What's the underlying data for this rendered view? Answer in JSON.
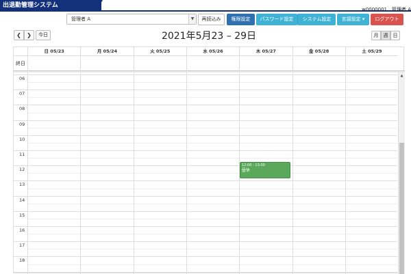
{
  "header": {
    "app_title": "出退勤管理システム",
    "user_info": "w0000001　管理者 A"
  },
  "toolbar": {
    "select_value": "管理者 A",
    "reload_label": "再読込み",
    "permission_label": "権限設定",
    "password_label": "パスワード設定",
    "system_label": "システム設定",
    "language_label": "言語設定 ▾",
    "logout_label": "ログアウト"
  },
  "calendar": {
    "prev_label": "❮",
    "next_label": "❯",
    "today_label": "今日",
    "title": "2021年5月23 – 29日",
    "views": [
      "月",
      "週",
      "日"
    ],
    "active_view": "週",
    "allday_label": "終日",
    "days": [
      "日 05/23",
      "月 05/24",
      "火 05/25",
      "水 05/26",
      "木 05/27",
      "金 05/28",
      "土 05/29"
    ],
    "hours": [
      "06",
      "07",
      "08",
      "09",
      "10",
      "11",
      "12",
      "13",
      "14",
      "15",
      "16",
      "17",
      "18",
      "19"
    ],
    "event": {
      "time": "12:00 - 13:00",
      "title": "昼休"
    }
  },
  "colors": {
    "brand": "#13307a",
    "primary": "#2f71b0",
    "info": "#3fb3d5",
    "danger": "#d9534f",
    "event": "#5aa85a"
  }
}
